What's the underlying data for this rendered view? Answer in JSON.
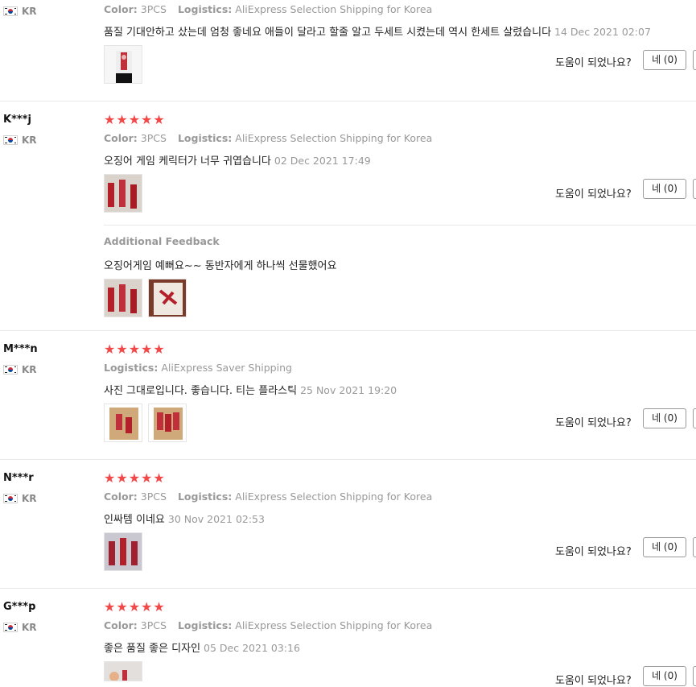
{
  "helpful_label": "도움이 되었나요?",
  "reviews": [
    {
      "user": "",
      "country": "KR",
      "meta_color_label": "Color:",
      "meta_color_value": "3PCS",
      "meta_logistics_label": "Logistics:",
      "meta_logistics_value": "AliExpress Selection Shipping for Korea",
      "text": "품질 기대안하고 샀는데 엄청 좋네요 애들이 달라고 할줄 알고 두세트 시켰는데 역시 한세트 살렸습니다",
      "date": "14 Dec 2021 02:07",
      "yes_label": "네 (0)"
    },
    {
      "user": "K***j",
      "country": "KR",
      "rating": 5,
      "meta_color_label": "Color:",
      "meta_color_value": "3PCS",
      "meta_logistics_label": "Logistics:",
      "meta_logistics_value": "AliExpress Selection Shipping for Korea",
      "text": "오징어 게임 케릭터가 너무 귀엽습니다",
      "date": "02 Dec 2021 17:49",
      "yes_label": "네 (0)",
      "additional_title": "Additional Feedback",
      "additional_text": "오징어게임 예뻐요~~ 동반자에게 하나씩 선물했어요"
    },
    {
      "user": "M***n",
      "country": "KR",
      "rating": 5,
      "meta_logistics_label": "Logistics:",
      "meta_logistics_value": "AliExpress Saver Shipping",
      "text": "사진 그대로입니다. 좋습니다. 티는 플라스틱",
      "date": "25 Nov 2021 19:20",
      "yes_label": "네 (0)"
    },
    {
      "user": "N***r",
      "country": "KR",
      "rating": 5,
      "meta_color_label": "Color:",
      "meta_color_value": "3PCS",
      "meta_logistics_label": "Logistics:",
      "meta_logistics_value": "AliExpress Selection Shipping for Korea",
      "text": "인싸템 이네요",
      "date": "30 Nov 2021 02:53",
      "yes_label": "네 (0)"
    },
    {
      "user": "G***p",
      "country": "KR",
      "rating": 5,
      "meta_color_label": "Color:",
      "meta_color_value": "3PCS",
      "meta_logistics_label": "Logistics:",
      "meta_logistics_value": "AliExpress Selection Shipping for Korea",
      "text": "좋은 품질 좋은 디자인",
      "date": "05 Dec 2021 03:16",
      "yes_label": "네 (0)"
    }
  ],
  "colors": {
    "star": "#f44747",
    "muted": "#999999",
    "divider": "#e8e8e8"
  }
}
